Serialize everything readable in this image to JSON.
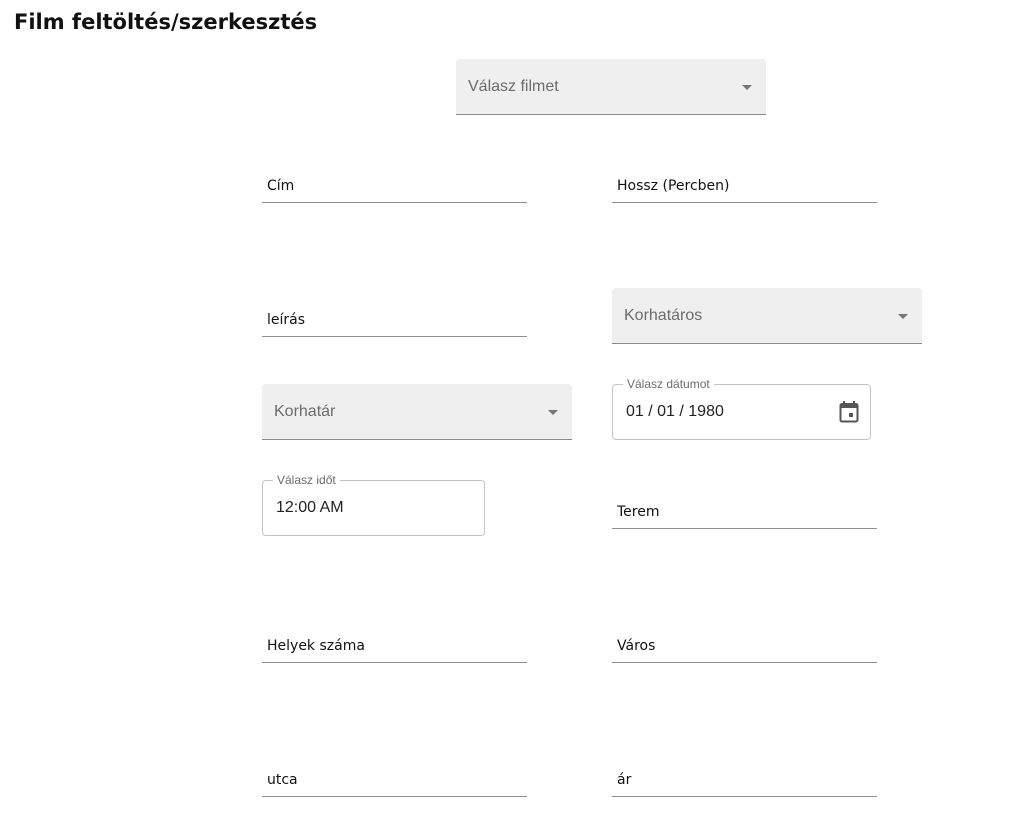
{
  "page": {
    "title": "Film feltöltés/szerkesztés"
  },
  "film_select": {
    "placeholder": "Válasz filmet",
    "icon": "arrow-drop-down"
  },
  "fields": {
    "cim": "Cím",
    "hossz": "Hossz (Percben)",
    "leiras": "leírás",
    "terem": "Terem",
    "helyek_szama": "Helyek száma",
    "varos": "Város",
    "utca": "utca",
    "ar": "ár"
  },
  "korhataros_select": {
    "placeholder": "Korhatáros",
    "icon": "arrow-drop-down"
  },
  "korhatar_select": {
    "placeholder": "Korhatár",
    "icon": "arrow-drop-down"
  },
  "date_picker": {
    "label": "Válasz dátumot",
    "value": "01 / 01 / 1980",
    "icon": "calendar-icon"
  },
  "time_picker": {
    "label": "Válasz időt",
    "value": "12:00 AM"
  }
}
